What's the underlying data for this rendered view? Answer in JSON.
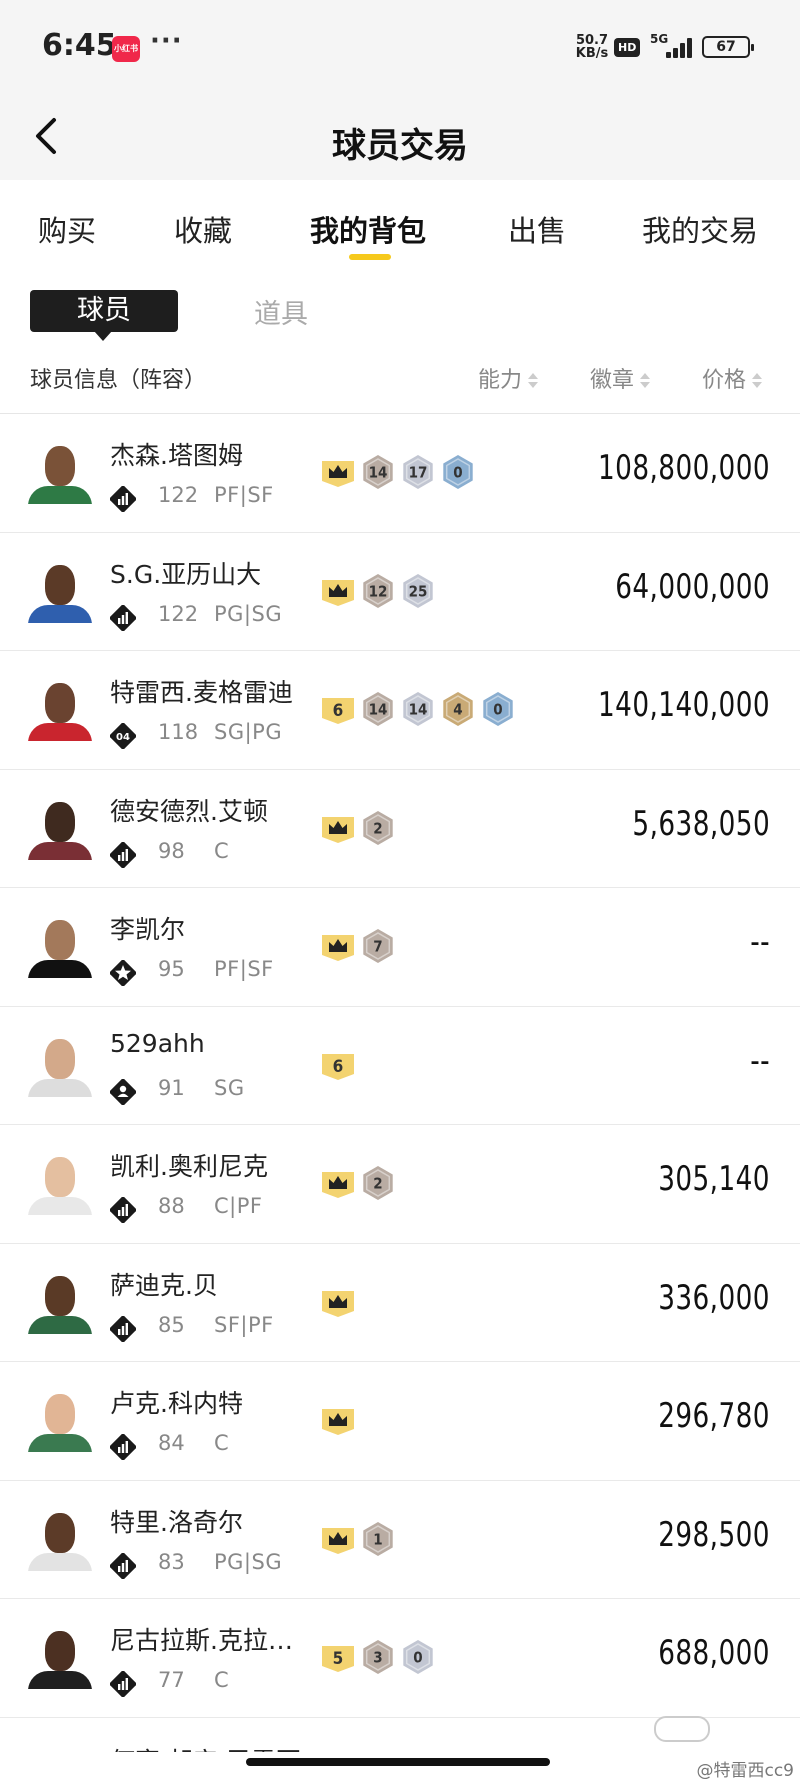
{
  "status_bar": {
    "time": "6:45",
    "app_icon_label": "小红书",
    "more": "···",
    "net_speed_value": "50.7",
    "net_speed_unit": "KB/s",
    "hd": "HD",
    "network": "5G",
    "battery": "67"
  },
  "header": {
    "title": "球员交易",
    "back_icon": "chevron-left-icon"
  },
  "tabs": [
    {
      "label": "购买"
    },
    {
      "label": "收藏"
    },
    {
      "label": "我的背包",
      "active": true
    },
    {
      "label": "出售"
    },
    {
      "label": "我的交易"
    }
  ],
  "subtabs": {
    "active": "球员",
    "inactive": "道具"
  },
  "columns": {
    "info": "球员信息（阵容）",
    "ability": "能力",
    "badges": "徽章",
    "price": "价格"
  },
  "colors": {
    "accent_yellow": "#f6c91c",
    "gold_badge": "#f3d370",
    "bronze_badge": "#b9aca3",
    "silver_badge": "#c2c6d2",
    "blue_badge": "#8aaed0",
    "hof_badge": "#c9aa76"
  },
  "players": [
    {
      "name": "杰森.塔图姆",
      "tier": "diamond",
      "rating": "122",
      "position": "PF|SF",
      "price": "108,800,000",
      "badges": [
        {
          "kind": "crown"
        },
        {
          "kind": "bronze",
          "value": "14"
        },
        {
          "kind": "silver",
          "value": "17"
        },
        {
          "kind": "blue",
          "value": "0"
        }
      ],
      "skin": "#7a5238",
      "jersey": "#2e7a45"
    },
    {
      "name": "S.G.亚历山大",
      "tier": "diamond",
      "rating": "122",
      "position": "PG|SG",
      "price": "64,000,000",
      "badges": [
        {
          "kind": "crown"
        },
        {
          "kind": "bronze",
          "value": "12"
        },
        {
          "kind": "silver",
          "value": "25"
        }
      ],
      "skin": "#5b3a27",
      "jersey": "#2f5fae"
    },
    {
      "name": "特雷西.麦格雷迪",
      "tier": "04",
      "rating": "118",
      "position": "SG|PG",
      "price": "140,140,000",
      "badges": [
        {
          "kind": "gold",
          "value": "6"
        },
        {
          "kind": "bronze",
          "value": "14"
        },
        {
          "kind": "silver",
          "value": "14"
        },
        {
          "kind": "hof",
          "value": "4"
        },
        {
          "kind": "blue",
          "value": "0"
        }
      ],
      "skin": "#6a4330",
      "jersey": "#c9252e"
    },
    {
      "name": "德安德烈.艾顿",
      "tier": "diamond",
      "rating": "98",
      "position": "C",
      "price": "5,638,050",
      "badges": [
        {
          "kind": "crown"
        },
        {
          "kind": "bronze",
          "value": "2"
        }
      ],
      "skin": "#3f2a1f",
      "jersey": "#7a2f35"
    },
    {
      "name": "李凯尔",
      "tier": "star",
      "rating": "95",
      "position": "PF|SF",
      "price": "--",
      "badges": [
        {
          "kind": "crown"
        },
        {
          "kind": "bronze",
          "value": "7"
        }
      ],
      "skin": "#a3795b",
      "jersey": "#111111"
    },
    {
      "name": "529ahh",
      "tier": "person",
      "rating": "91",
      "position": "SG",
      "price": "--",
      "badges": [
        {
          "kind": "gold",
          "value": "6"
        }
      ],
      "skin": "#d3a98a",
      "jersey": "#dddddd"
    },
    {
      "name": "凯利.奥利尼克",
      "tier": "diamond",
      "rating": "88",
      "position": "C|PF",
      "price": "305,140",
      "badges": [
        {
          "kind": "crown"
        },
        {
          "kind": "bronze",
          "value": "2"
        }
      ],
      "skin": "#e4bfa0",
      "jersey": "#e8e8e8"
    },
    {
      "name": "萨迪克.贝",
      "tier": "diamond",
      "rating": "85",
      "position": "SF|PF",
      "price": "336,000",
      "badges": [
        {
          "kind": "crown"
        }
      ],
      "skin": "#5a3a26",
      "jersey": "#2e6a44"
    },
    {
      "name": "卢克.科内特",
      "tier": "diamond",
      "rating": "84",
      "position": "C",
      "price": "296,780",
      "badges": [
        {
          "kind": "crown"
        }
      ],
      "skin": "#e1b595",
      "jersey": "#3a7a50"
    },
    {
      "name": "特里.洛奇尔",
      "tier": "diamond",
      "rating": "83",
      "position": "PG|SG",
      "price": "298,500",
      "badges": [
        {
          "kind": "crown"
        },
        {
          "kind": "bronze",
          "value": "1"
        }
      ],
      "skin": "#5c3b28",
      "jersey": "#e3e3e3"
    },
    {
      "name": "尼古拉斯.克拉…",
      "tier": "diamond",
      "rating": "77",
      "position": "C",
      "price": "688,000",
      "badges": [
        {
          "kind": "gold",
          "value": "5"
        },
        {
          "kind": "bronze",
          "value": "3"
        },
        {
          "kind": "silver",
          "value": "0"
        }
      ],
      "skin": "#4c3022",
      "jersey": "#1f1f1f"
    }
  ],
  "partial_row_name": "何塞.胡安.巴雷亚",
  "watermark": "@特雷西cc9"
}
